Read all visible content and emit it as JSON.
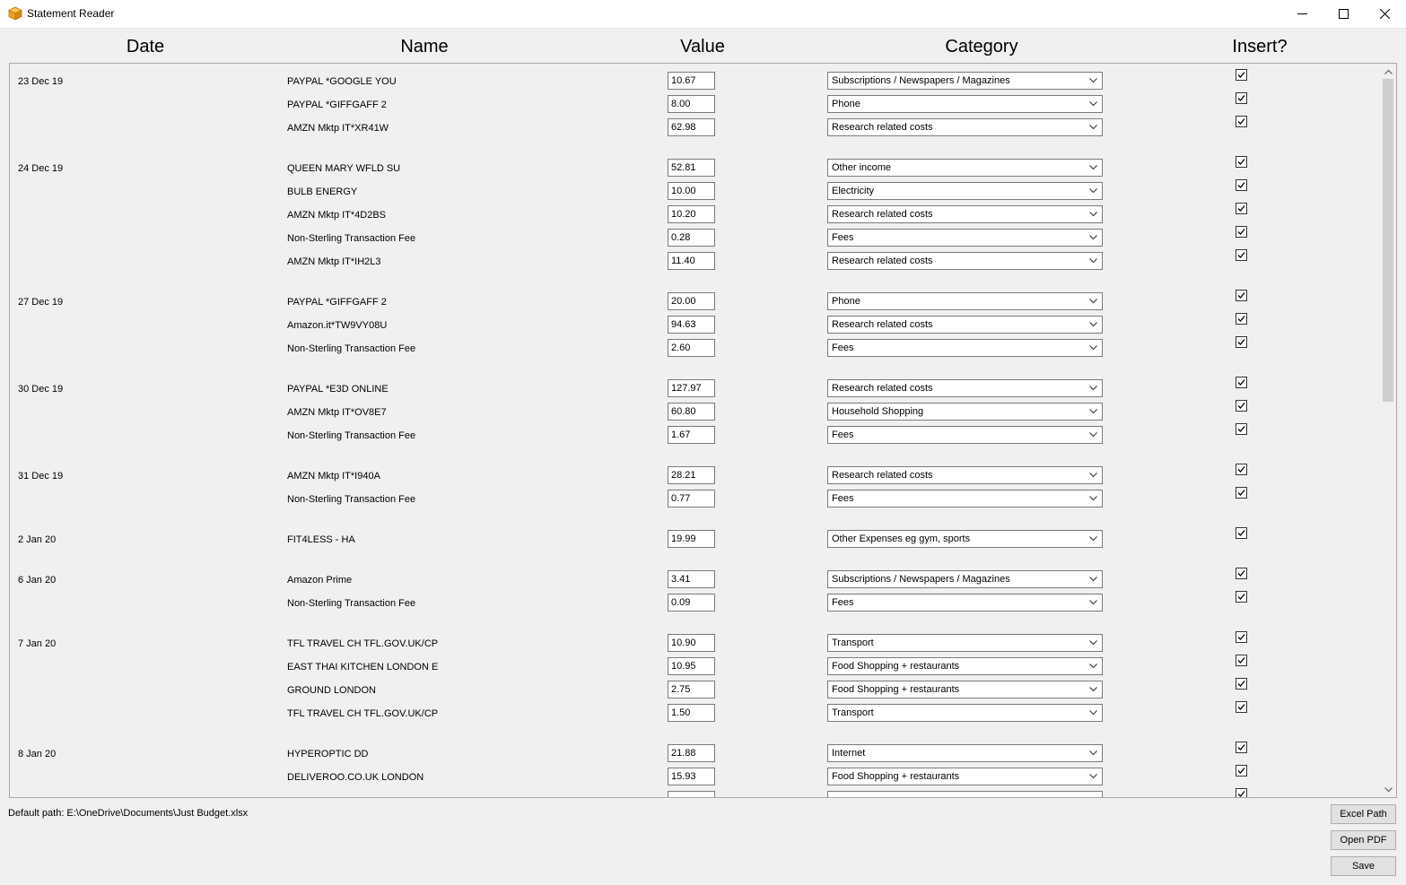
{
  "window": {
    "title": "Statement Reader"
  },
  "headers": {
    "date": "Date",
    "name": "Name",
    "value": "Value",
    "category": "Category",
    "insert": "Insert?"
  },
  "groups": [
    {
      "date": "23 Dec 19",
      "rows": [
        {
          "name": "PAYPAL *GOOGLE YOU",
          "value": "10.67",
          "category": "Subscriptions / Newspapers / Magazines",
          "insert": true
        },
        {
          "name": "PAYPAL *GIFFGAFF 2",
          "value": "8.00",
          "category": "Phone",
          "insert": true
        },
        {
          "name": "AMZN Mktp IT*XR41W",
          "value": "62.98",
          "category": "Research related costs",
          "insert": true
        }
      ]
    },
    {
      "date": "24 Dec 19",
      "rows": [
        {
          "name": "QUEEN MARY WFLD SU",
          "value": "52.81",
          "category": "Other income",
          "insert": true
        },
        {
          "name": "BULB ENERGY",
          "value": "10.00",
          "category": "Electricity",
          "insert": true
        },
        {
          "name": "AMZN Mktp IT*4D2BS",
          "value": "10.20",
          "category": "Research related costs",
          "insert": true
        },
        {
          "name": "Non-Sterling Transaction Fee",
          "value": "0.28",
          "category": "Fees",
          "insert": true
        },
        {
          "name": "AMZN Mktp IT*IH2L3",
          "value": "11.40",
          "category": "Research related costs",
          "insert": true
        }
      ]
    },
    {
      "date": "27 Dec 19",
      "rows": [
        {
          "name": "PAYPAL *GIFFGAFF 2",
          "value": "20.00",
          "category": "Phone",
          "insert": true
        },
        {
          "name": "Amazon.it*TW9VY08U",
          "value": "94.63",
          "category": "Research related costs",
          "insert": true
        },
        {
          "name": "Non-Sterling Transaction Fee",
          "value": "2.60",
          "category": "Fees",
          "insert": true
        }
      ]
    },
    {
      "date": "30 Dec 19",
      "rows": [
        {
          "name": "PAYPAL *E3D ONLINE",
          "value": "127.97",
          "category": "Research related costs",
          "insert": true
        },
        {
          "name": "AMZN Mktp IT*OV8E7",
          "value": "60.80",
          "category": "Household Shopping",
          "insert": true
        },
        {
          "name": "Non-Sterling Transaction Fee",
          "value": "1.67",
          "category": "Fees",
          "insert": true
        }
      ]
    },
    {
      "date": "31 Dec 19",
      "rows": [
        {
          "name": "AMZN Mktp IT*I940A",
          "value": "28.21",
          "category": "Research related costs",
          "insert": true
        },
        {
          "name": "Non-Sterling Transaction Fee",
          "value": "0.77",
          "category": "Fees",
          "insert": true
        }
      ]
    },
    {
      "date": "2 Jan 20",
      "rows": [
        {
          "name": "FIT4LESS - HA",
          "value": "19.99",
          "category": "Other Expenses eg gym, sports",
          "insert": true
        }
      ]
    },
    {
      "date": "6 Jan 20",
      "rows": [
        {
          "name": "Amazon Prime",
          "value": "3.41",
          "category": "Subscriptions / Newspapers / Magazines",
          "insert": true
        },
        {
          "name": "Non-Sterling Transaction Fee",
          "value": "0.09",
          "category": "Fees",
          "insert": true
        }
      ]
    },
    {
      "date": "7 Jan 20",
      "rows": [
        {
          "name": "TFL TRAVEL CH TFL.GOV.UK/CP",
          "value": "10.90",
          "category": "Transport",
          "insert": true
        },
        {
          "name": "EAST THAI KITCHEN LONDON  E",
          "value": "10.95",
          "category": "Food Shopping + restaurants",
          "insert": true
        },
        {
          "name": "GROUND LONDON",
          "value": "2.75",
          "category": "Food Shopping + restaurants",
          "insert": true
        },
        {
          "name": "TFL TRAVEL CH TFL.GOV.UK/CP",
          "value": "1.50",
          "category": "Transport",
          "insert": true
        }
      ]
    },
    {
      "date": "8 Jan 20",
      "rows": [
        {
          "name": "HYPEROPTIC DD",
          "value": "21.88",
          "category": "Internet",
          "insert": true
        },
        {
          "name": "DELIVEROO.CO.UK LONDON",
          "value": "15.93",
          "category": "Food Shopping + restaurants",
          "insert": true,
          "focused": true
        },
        {
          "name": "",
          "value": "",
          "category": "",
          "insert": true
        }
      ]
    }
  ],
  "footer": {
    "default_path": "Default path: E:\\OneDrive\\Documents\\Just Budget.xlsx"
  },
  "buttons": {
    "excel_path": "Excel Path",
    "open_pdf": "Open PDF",
    "save": "Save"
  },
  "colors": {
    "title_bar": "#ffffff",
    "window_bg": "#f0f0f0",
    "app_icon": "#f5a623"
  }
}
